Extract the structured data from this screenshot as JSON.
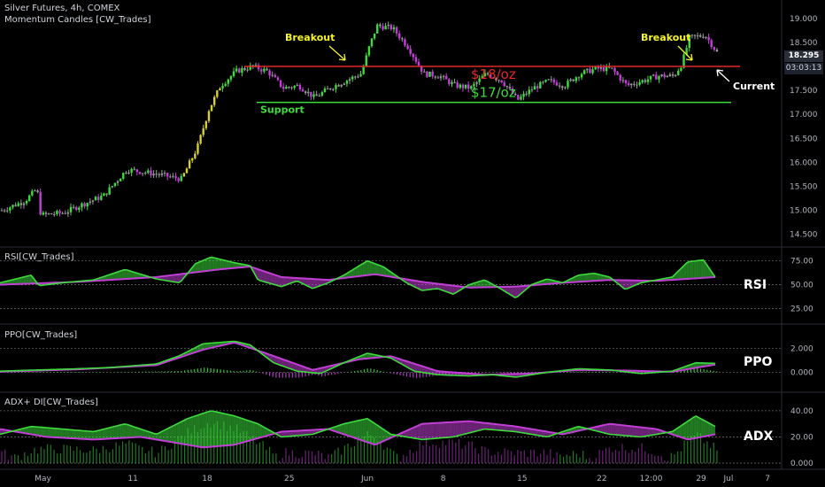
{
  "header": {
    "line1": "Silver Futures, 4h, COMEX",
    "line2": "Momentum Candles [CW_Trades]"
  },
  "panes": [
    {
      "header": "RSI[CW_Trades]",
      "tag": "RSI"
    },
    {
      "header": "PPO[CW_Trades]",
      "tag": "PPO"
    },
    {
      "header": "ADX+ DI[CW_Trades]",
      "tag": "ADX"
    }
  ],
  "price_box": {
    "price": "18.295",
    "countdown": "03:03:13"
  },
  "annotations": {
    "breakout_left": "Breakout",
    "breakout_right": "Breakout",
    "support": "Support",
    "resistance_price": "$18/oz",
    "support_price": "$17/oz",
    "current": "Current"
  },
  "colors": {
    "background": "#000000",
    "resistance": "#e02828",
    "support": "#3ddc3d",
    "annotation": "#f5f52a",
    "bull": "#3ddc3d",
    "bear": "#c23fd6",
    "neutral": "#888888"
  },
  "chart_data": [
    {
      "type": "candlestick",
      "title": "Silver Futures, 4h, COMEX",
      "x_ticks": [
        "May",
        "11",
        "18",
        "25",
        "Jun",
        "8",
        "15",
        "22",
        "12:00",
        "29",
        "Jul",
        "7"
      ],
      "y_ticks": [
        "19.000",
        "18.500",
        "18.000",
        "17.500",
        "17.000",
        "16.500",
        "16.000",
        "15.500",
        "15.000",
        "14.500"
      ],
      "ylim": [
        14.4,
        19.2
      ],
      "close_path": [
        [
          0,
          15.0
        ],
        [
          0.03,
          15.2
        ],
        [
          0.045,
          15.45
        ],
        [
          0.05,
          14.9
        ],
        [
          0.08,
          14.95
        ],
        [
          0.1,
          15.1
        ],
        [
          0.13,
          15.3
        ],
        [
          0.16,
          15.85
        ],
        [
          0.2,
          15.75
        ],
        [
          0.23,
          15.65
        ],
        [
          0.25,
          16.3
        ],
        [
          0.265,
          17.1
        ],
        [
          0.28,
          17.6
        ],
        [
          0.3,
          17.9
        ],
        [
          0.32,
          18.0
        ],
        [
          0.34,
          17.9
        ],
        [
          0.36,
          17.55
        ],
        [
          0.38,
          17.6
        ],
        [
          0.4,
          17.35
        ],
        [
          0.42,
          17.55
        ],
        [
          0.44,
          17.7
        ],
        [
          0.46,
          17.85
        ],
        [
          0.47,
          18.4
        ],
        [
          0.48,
          18.85
        ],
        [
          0.5,
          18.8
        ],
        [
          0.52,
          18.4
        ],
        [
          0.54,
          17.85
        ],
        [
          0.56,
          17.8
        ],
        [
          0.58,
          17.6
        ],
        [
          0.6,
          17.55
        ],
        [
          0.62,
          17.85
        ],
        [
          0.64,
          17.7
        ],
        [
          0.66,
          17.3
        ],
        [
          0.68,
          17.55
        ],
        [
          0.7,
          17.7
        ],
        [
          0.72,
          17.6
        ],
        [
          0.74,
          17.85
        ],
        [
          0.76,
          17.95
        ],
        [
          0.78,
          17.95
        ],
        [
          0.8,
          17.6
        ],
        [
          0.82,
          17.7
        ],
        [
          0.84,
          17.8
        ],
        [
          0.86,
          17.8
        ],
        [
          0.87,
          18.05
        ],
        [
          0.88,
          18.6
        ],
        [
          0.9,
          18.65
        ],
        [
          0.915,
          18.295
        ]
      ],
      "resistance_level": 18.0,
      "support_level": 17.25
    },
    {
      "type": "line",
      "name": "RSI",
      "y_ticks": [
        "75.00",
        "50.00",
        "25.00"
      ],
      "ylim": [
        18,
        83
      ],
      "path": [
        [
          0,
          52
        ],
        [
          0.04,
          60
        ],
        [
          0.05,
          49
        ],
        [
          0.08,
          52
        ],
        [
          0.12,
          55
        ],
        [
          0.16,
          66
        ],
        [
          0.2,
          56
        ],
        [
          0.23,
          52
        ],
        [
          0.25,
          72
        ],
        [
          0.27,
          79
        ],
        [
          0.3,
          73
        ],
        [
          0.32,
          70
        ],
        [
          0.33,
          55
        ],
        [
          0.36,
          48
        ],
        [
          0.38,
          54
        ],
        [
          0.4,
          46
        ],
        [
          0.42,
          52
        ],
        [
          0.44,
          60
        ],
        [
          0.47,
          75
        ],
        [
          0.49,
          69
        ],
        [
          0.52,
          52
        ],
        [
          0.54,
          44
        ],
        [
          0.56,
          46
        ],
        [
          0.58,
          40
        ],
        [
          0.6,
          50
        ],
        [
          0.62,
          55
        ],
        [
          0.64,
          46
        ],
        [
          0.66,
          36
        ],
        [
          0.68,
          50
        ],
        [
          0.7,
          56
        ],
        [
          0.72,
          52
        ],
        [
          0.74,
          60
        ],
        [
          0.76,
          62
        ],
        [
          0.78,
          58
        ],
        [
          0.8,
          45
        ],
        [
          0.82,
          52
        ],
        [
          0.84,
          55
        ],
        [
          0.86,
          58
        ],
        [
          0.88,
          74
        ],
        [
          0.9,
          76
        ],
        [
          0.915,
          58
        ]
      ],
      "signal_path": [
        [
          0,
          50
        ],
        [
          0.1,
          53
        ],
        [
          0.2,
          58
        ],
        [
          0.28,
          66
        ],
        [
          0.32,
          69
        ],
        [
          0.36,
          58
        ],
        [
          0.42,
          55
        ],
        [
          0.48,
          61
        ],
        [
          0.54,
          53
        ],
        [
          0.6,
          47
        ],
        [
          0.66,
          48
        ],
        [
          0.72,
          52
        ],
        [
          0.78,
          55
        ],
        [
          0.84,
          54
        ],
        [
          0.915,
          58
        ]
      ]
    },
    {
      "type": "line",
      "name": "PPO",
      "y_ticks": [
        "2.000",
        "0.000"
      ],
      "ylim": [
        -1.0,
        3.3
      ],
      "path": [
        [
          0,
          0.1
        ],
        [
          0.05,
          0.2
        ],
        [
          0.1,
          0.3
        ],
        [
          0.14,
          0.4
        ],
        [
          0.17,
          0.55
        ],
        [
          0.2,
          0.7
        ],
        [
          0.23,
          1.4
        ],
        [
          0.26,
          2.4
        ],
        [
          0.3,
          2.6
        ],
        [
          0.32,
          2.3
        ],
        [
          0.35,
          0.8
        ],
        [
          0.38,
          0.1
        ],
        [
          0.41,
          -0.1
        ],
        [
          0.44,
          0.8
        ],
        [
          0.47,
          1.6
        ],
        [
          0.5,
          1.2
        ],
        [
          0.53,
          0.1
        ],
        [
          0.56,
          -0.2
        ],
        [
          0.6,
          -0.3
        ],
        [
          0.63,
          -0.2
        ],
        [
          0.66,
          -0.4
        ],
        [
          0.7,
          0.0
        ],
        [
          0.74,
          0.3
        ],
        [
          0.78,
          0.2
        ],
        [
          0.82,
          -0.1
        ],
        [
          0.86,
          0.1
        ],
        [
          0.89,
          0.8
        ],
        [
          0.915,
          0.75
        ]
      ],
      "signal_path": [
        [
          0,
          0.05
        ],
        [
          0.1,
          0.25
        ],
        [
          0.2,
          0.6
        ],
        [
          0.26,
          1.9
        ],
        [
          0.3,
          2.5
        ],
        [
          0.34,
          1.6
        ],
        [
          0.4,
          0.2
        ],
        [
          0.46,
          1.1
        ],
        [
          0.5,
          1.35
        ],
        [
          0.56,
          0.1
        ],
        [
          0.62,
          -0.2
        ],
        [
          0.68,
          -0.1
        ],
        [
          0.74,
          0.2
        ],
        [
          0.8,
          0.15
        ],
        [
          0.86,
          0.05
        ],
        [
          0.915,
          0.65
        ]
      ]
    },
    {
      "type": "line",
      "name": "ADX+ DI",
      "y_ticks": [
        "40.00",
        "20.00",
        "0.000"
      ],
      "ylim": [
        -2,
        48
      ],
      "path": [
        [
          0,
          22
        ],
        [
          0.04,
          28
        ],
        [
          0.08,
          26
        ],
        [
          0.12,
          24
        ],
        [
          0.16,
          30
        ],
        [
          0.2,
          22
        ],
        [
          0.24,
          34
        ],
        [
          0.27,
          40
        ],
        [
          0.3,
          36
        ],
        [
          0.33,
          30
        ],
        [
          0.36,
          20
        ],
        [
          0.4,
          22
        ],
        [
          0.44,
          30
        ],
        [
          0.47,
          34
        ],
        [
          0.5,
          22
        ],
        [
          0.54,
          18
        ],
        [
          0.58,
          20
        ],
        [
          0.62,
          26
        ],
        [
          0.66,
          24
        ],
        [
          0.7,
          20
        ],
        [
          0.74,
          28
        ],
        [
          0.78,
          22
        ],
        [
          0.82,
          20
        ],
        [
          0.86,
          24
        ],
        [
          0.89,
          36
        ],
        [
          0.915,
          28
        ]
      ],
      "signal_path": [
        [
          0,
          26
        ],
        [
          0.06,
          20
        ],
        [
          0.12,
          18
        ],
        [
          0.18,
          20
        ],
        [
          0.22,
          16
        ],
        [
          0.26,
          12
        ],
        [
          0.3,
          14
        ],
        [
          0.36,
          24
        ],
        [
          0.42,
          26
        ],
        [
          0.48,
          14
        ],
        [
          0.54,
          30
        ],
        [
          0.6,
          32
        ],
        [
          0.66,
          28
        ],
        [
          0.72,
          22
        ],
        [
          0.78,
          30
        ],
        [
          0.84,
          26
        ],
        [
          0.88,
          18
        ],
        [
          0.915,
          22
        ]
      ]
    }
  ]
}
